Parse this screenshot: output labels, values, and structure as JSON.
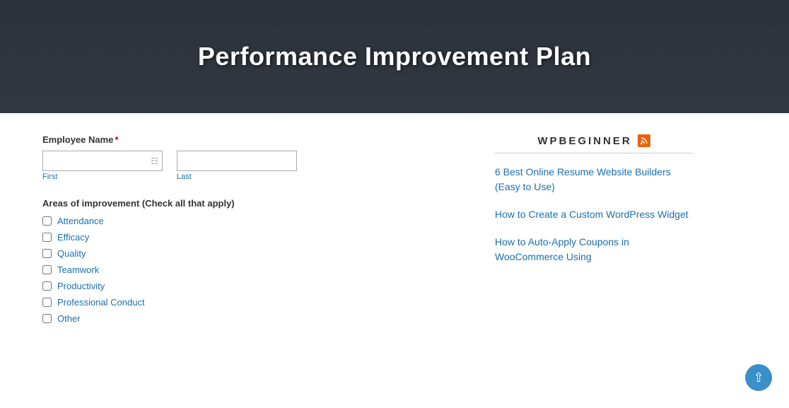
{
  "hero": {
    "title": "Performance Improvement Plan"
  },
  "form": {
    "employee_name_label": "Employee Name",
    "required_marker": "*",
    "first_sublabel": "First",
    "last_sublabel": "Last",
    "areas_label": "Areas of improvement (Check all that apply)",
    "checkboxes": [
      {
        "id": "cb-attendance",
        "label": "Attendance"
      },
      {
        "id": "cb-efficacy",
        "label": "Efficacy"
      },
      {
        "id": "cb-quality",
        "label": "Quality"
      },
      {
        "id": "cb-teamwork",
        "label": "Teamwork"
      },
      {
        "id": "cb-productivity",
        "label": "Productivity"
      },
      {
        "id": "cb-professional",
        "label": "Professional Conduct"
      },
      {
        "id": "cb-other",
        "label": "Other"
      }
    ]
  },
  "sidebar": {
    "title": "WPBEGINNER",
    "links": [
      {
        "text": "6 Best Online Resume Website Builders (Easy to Use)"
      },
      {
        "text": "How to Create a Custom WordPress Widget"
      },
      {
        "text": "How to Auto-Apply Coupons in WooCommerce Using"
      }
    ]
  },
  "scroll_top_label": "↑"
}
